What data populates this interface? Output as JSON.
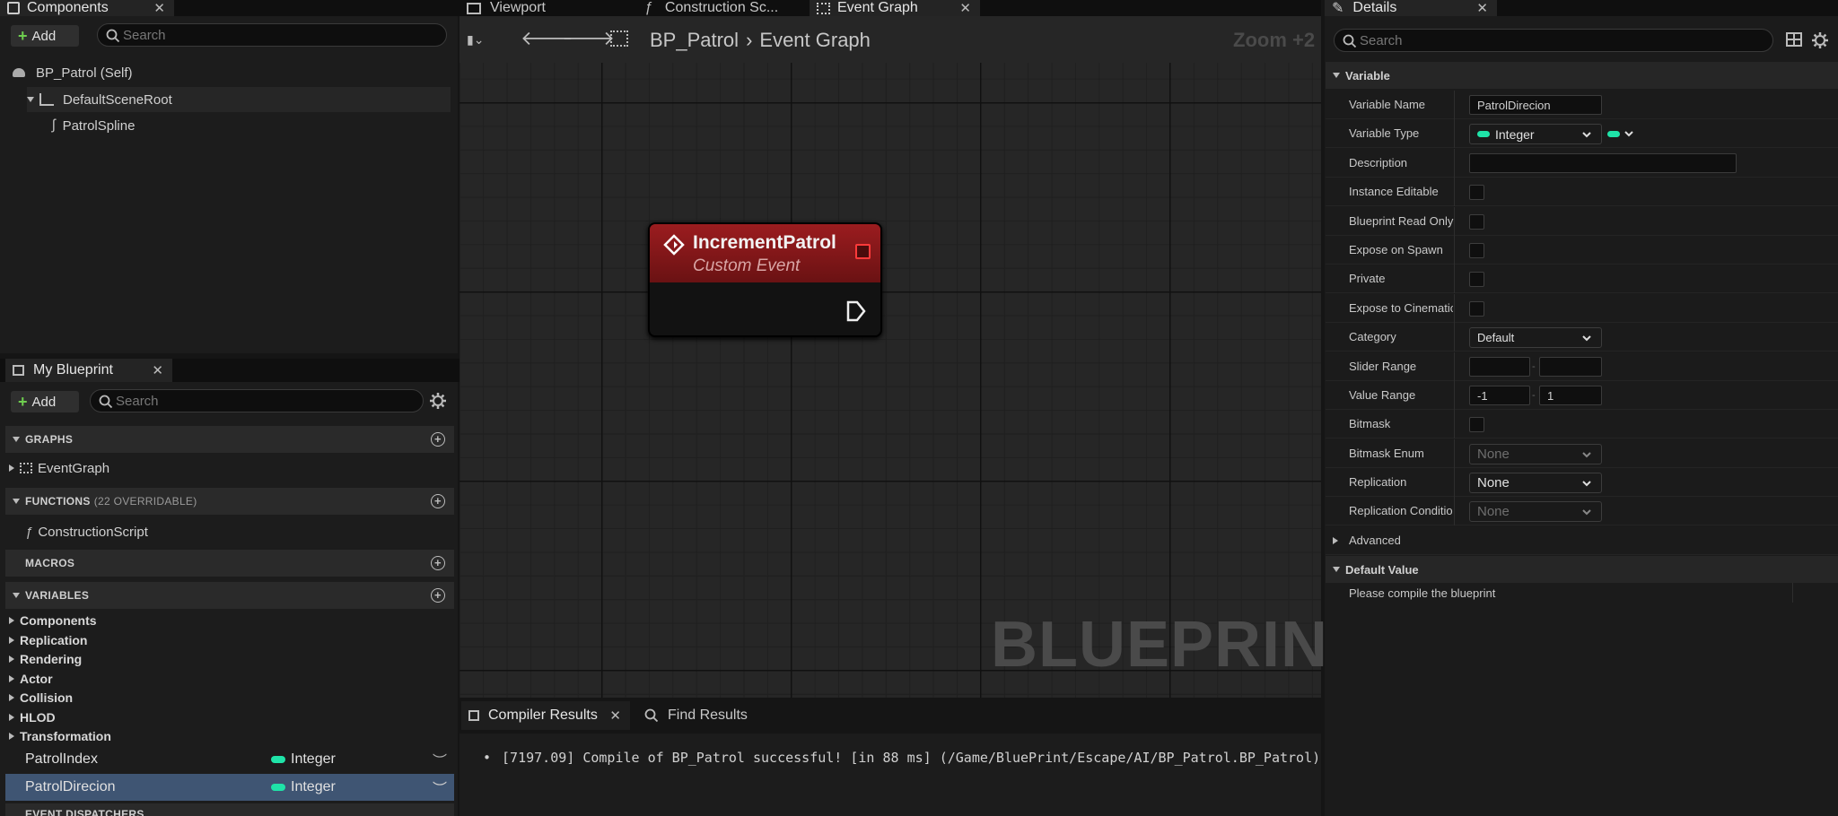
{
  "components_panel": {
    "tab_title": "Components",
    "add_label": "Add",
    "search_placeholder": "Search",
    "tree": {
      "self": "BP_Patrol (Self)",
      "root": "DefaultSceneRoot",
      "child": "PatrolSpline"
    }
  },
  "editor_tabs": {
    "viewport": "Viewport",
    "construction": "Construction Sc...",
    "event_graph": "Event Graph"
  },
  "graph_toolbar": {
    "breadcrumb_root": "BP_Patrol",
    "breadcrumb_current": "Event Graph",
    "zoom": "Zoom +2"
  },
  "node": {
    "title": "IncrementPatrol",
    "subtitle": "Custom Event"
  },
  "watermark": "BLUEPRINT",
  "my_blueprint": {
    "tab_title": "My Blueprint",
    "add_label": "Add",
    "search_placeholder": "Search",
    "graphs_label": "GRAPHS",
    "graphs": [
      "EventGraph"
    ],
    "functions_label": "FUNCTIONS",
    "functions_sub": "(22 OVERRIDABLE)",
    "functions": [
      "ConstructionScript"
    ],
    "macros_label": "MACROS",
    "variables_label": "VARIABLES",
    "categories": [
      "Components",
      "Replication",
      "Rendering",
      "Actor",
      "Collision",
      "HLOD",
      "Transformation"
    ],
    "variables": [
      {
        "name": "PatrolIndex",
        "type": "Integer"
      },
      {
        "name": "PatrolDirecion",
        "type": "Integer"
      }
    ],
    "event_dispatchers_label": "EVENT DISPATCHERS"
  },
  "bottom_panel": {
    "tab_compiler": "Compiler Results",
    "tab_find": "Find Results",
    "log": "[7197.09] Compile of BP_Patrol successful! [in 88 ms] (/Game/BluePrint/Escape/AI/BP_Patrol.BP_Patrol)"
  },
  "details": {
    "tab_title": "Details",
    "search_placeholder": "Search",
    "variable_section": "Variable",
    "labels": {
      "name": "Variable Name",
      "type": "Variable Type",
      "description": "Description",
      "instance_editable": "Instance Editable",
      "read_only": "Blueprint Read Only",
      "expose_spawn": "Expose on Spawn",
      "private": "Private",
      "expose_cinematics": "Expose to Cinematics",
      "category": "Category",
      "slider_range": "Slider Range",
      "value_range": "Value Range",
      "bitmask": "Bitmask",
      "bitmask_enum": "Bitmask Enum",
      "replication": "Replication",
      "replication_condition": "Replication Condition"
    },
    "values": {
      "name": "PatrolDirecion",
      "type": "Integer",
      "category": "Default",
      "value_min": "-1",
      "value_max": "1",
      "bitmask_enum": "None",
      "replication": "None",
      "replication_condition": "None"
    },
    "advanced_label": "Advanced",
    "default_value_section": "Default Value",
    "default_value_msg": "Please compile the blueprint"
  },
  "colors": {
    "integer_pin": "#1fe3a8",
    "node_header": "#9b1c1f",
    "selected_row": "#3f5573"
  }
}
